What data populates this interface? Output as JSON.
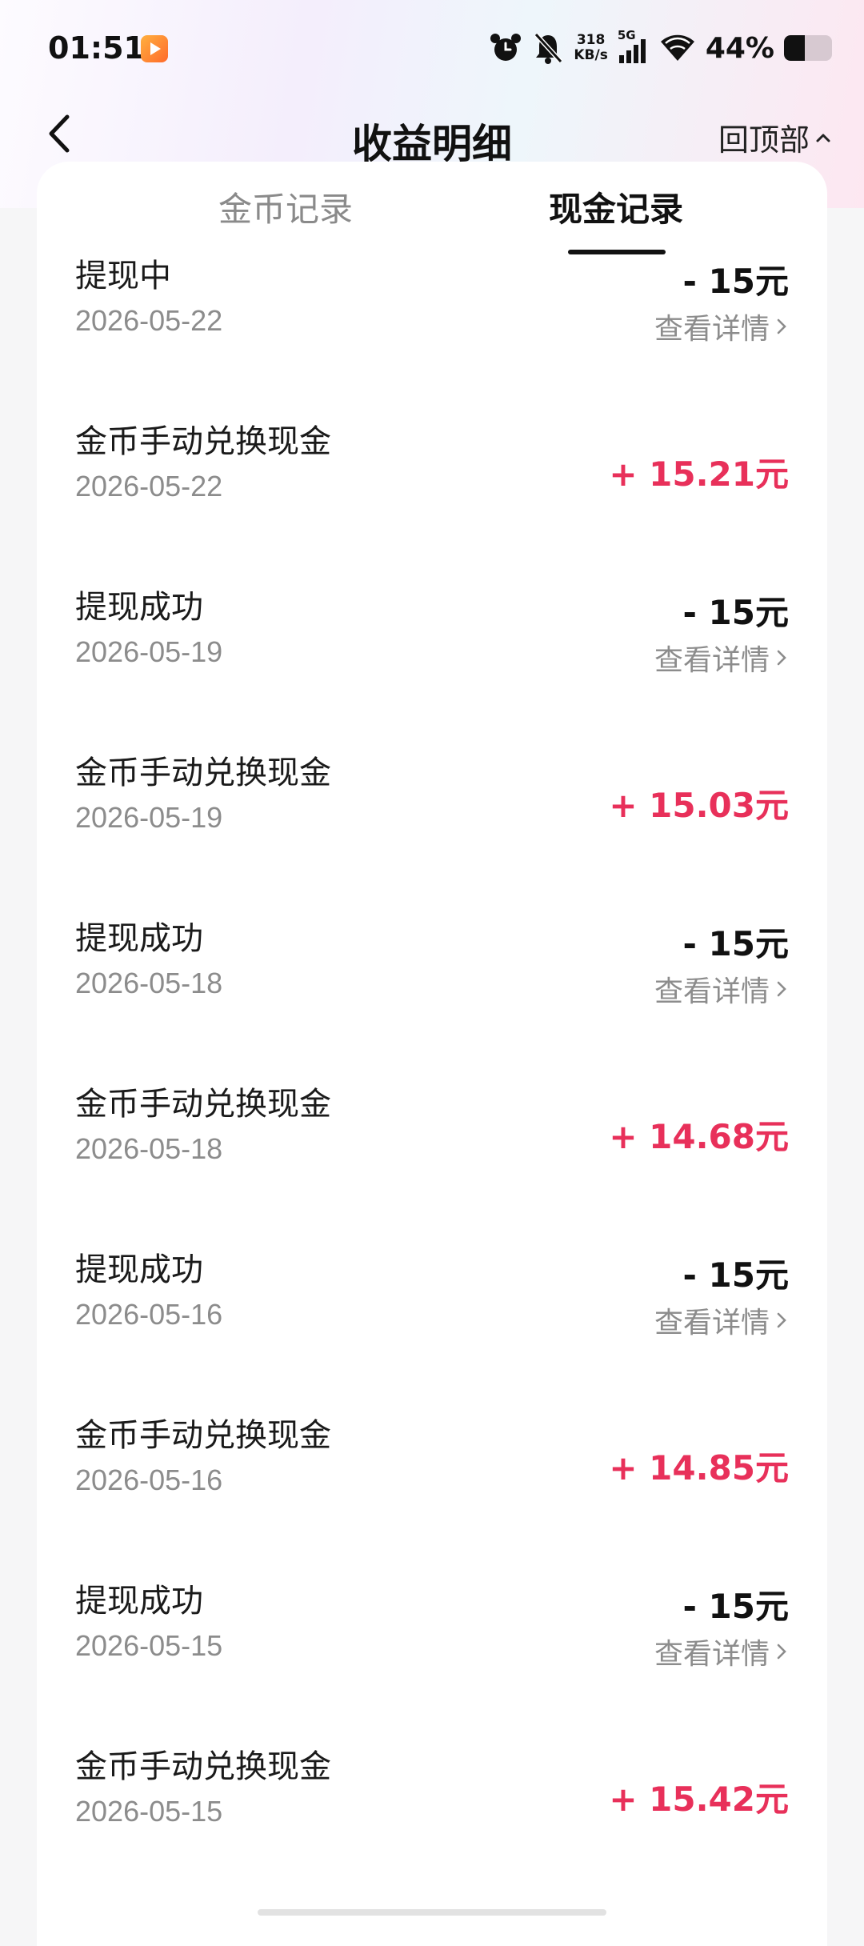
{
  "status_bar": {
    "time": "01:51",
    "net_speed_value": "318",
    "net_speed_unit": "KB/s",
    "network": "5G",
    "battery_percent": "44%",
    "battery_level": 0.44
  },
  "header": {
    "title": "收益明细",
    "back_to_top": "回顶部"
  },
  "tabs": [
    {
      "label": "金币记录",
      "active": false
    },
    {
      "label": "现金记录",
      "active": true
    }
  ],
  "records": [
    {
      "title": "提现中",
      "date": "2026-05-22",
      "amount": "- 15元",
      "detail": "查看详情"
    },
    {
      "title": "金币手动兑换现金",
      "date": "2026-05-22",
      "amount": "+ 15.21元"
    },
    {
      "title": "提现成功",
      "date": "2026-05-19",
      "amount": "- 15元",
      "detail": "查看详情"
    },
    {
      "title": "金币手动兑换现金",
      "date": "2026-05-19",
      "amount": "+ 15.03元"
    },
    {
      "title": "提现成功",
      "date": "2026-05-18",
      "amount": "- 15元",
      "detail": "查看详情"
    },
    {
      "title": "金币手动兑换现金",
      "date": "2026-05-18",
      "amount": "+ 14.68元"
    },
    {
      "title": "提现成功",
      "date": "2026-05-16",
      "amount": "- 15元",
      "detail": "查看详情"
    },
    {
      "title": "金币手动兑换现金",
      "date": "2026-05-16",
      "amount": "+ 14.85元"
    },
    {
      "title": "提现成功",
      "date": "2026-05-15",
      "amount": "- 15元",
      "detail": "查看详情"
    },
    {
      "title": "金币手动兑换现金",
      "date": "2026-05-15",
      "amount": "+ 15.42元"
    }
  ],
  "colors": {
    "positive_amount": "#e8305a",
    "negative_amount": "#111111",
    "secondary_text": "#8c8c8c"
  }
}
